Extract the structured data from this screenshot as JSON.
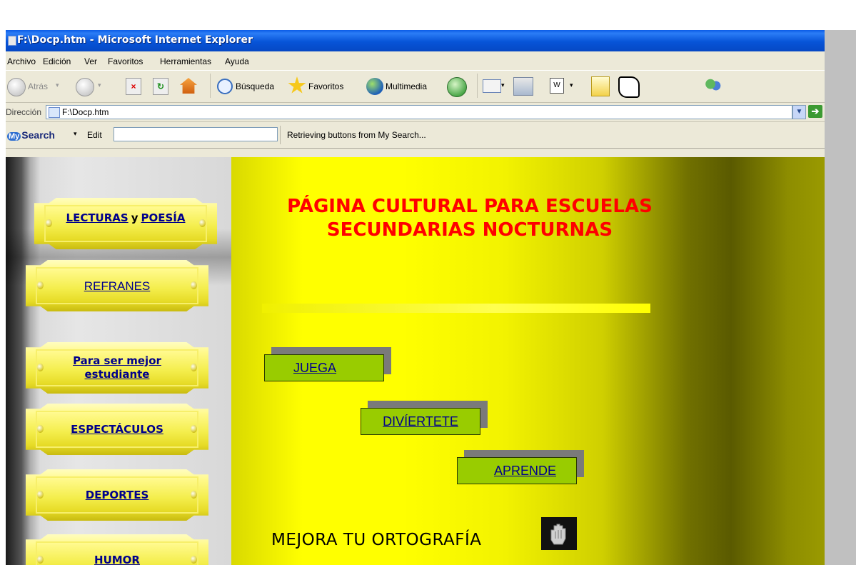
{
  "window": {
    "title": "F:\\Docp.htm - Microsoft Internet Explorer"
  },
  "menu": [
    "Archivo",
    "Edición",
    "Ver",
    "Favoritos",
    "Herramientas",
    "Ayuda"
  ],
  "toolbar": {
    "back_label": "Atrás",
    "search_label": "Búsqueda",
    "favorites_label": "Favoritos",
    "multimedia_label": "Multimedia"
  },
  "address": {
    "label": "Dirección",
    "value": "F:\\Docp.htm"
  },
  "mysearch": {
    "logo_prefix": "My",
    "logo_text": "Search",
    "edit_label": "Edit",
    "status": "Retrieving buttons from My Search..."
  },
  "sidebar": {
    "lecturas": "LECTURAS",
    "y": "y",
    "poesia": "POESÍA",
    "items": [
      "REFRANES",
      "Para ser mejor estudiante",
      "ESPECTÁCULOS",
      "DEPORTES",
      "HUMOR"
    ]
  },
  "page": {
    "heading_line1": "PÁGINA CULTURAL PARA ESCUELAS",
    "heading_line2": "SECUNDARIAS NOCTURNAS",
    "buttons": [
      "JUEGA",
      "DIVÍERTETE",
      "APRENDE"
    ],
    "ortografia": "MEJORA TU ORTOGRAFÍA"
  }
}
